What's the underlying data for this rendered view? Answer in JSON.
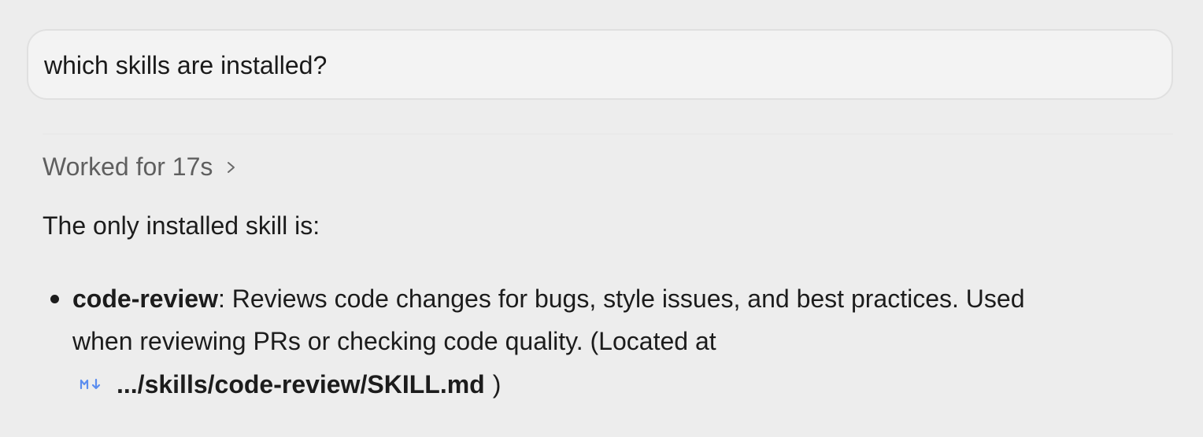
{
  "user_message": {
    "text": "which skills are installed?"
  },
  "assistant": {
    "worked_for": "Worked for 17s",
    "intro": "The only installed skill is:",
    "skill": {
      "name": "code-review",
      "description_line1": ": Reviews code changes for bugs, style issues, and best practices. Used",
      "description_line2": "when reviewing PRs or checking code quality. (Located at",
      "file_icon": "markdown-file-icon",
      "file_path": ".../skills/code-review/SKILL.md",
      "close_paren": ")"
    }
  },
  "colors": {
    "background": "#ededed",
    "message_bubble": "#f3f3f3",
    "muted_text": "#5f5f5f",
    "markdown_icon": "#5b8def"
  }
}
